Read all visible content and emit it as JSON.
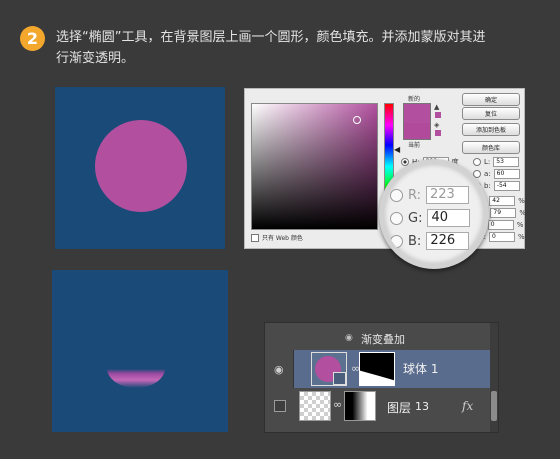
{
  "step": {
    "number": "2",
    "instruction_line1": "选择“椭圆”工具，在背景图层上画一个圆形，颜色填充。并添加蒙版对其进",
    "instruction_line2": "行渐变透明。"
  },
  "colors": {
    "accent": "#f3a72c",
    "canvas_bg": "#1a4a78",
    "fill": "#b2509f",
    "layer_selected": "#5a6c8e"
  },
  "color_picker": {
    "new_label": "新的",
    "current_label": "当前",
    "buttons": [
      "确定",
      "复位",
      "添加到色板",
      "颜色库"
    ],
    "hsb": [
      {
        "label": "H:",
        "value": "298",
        "unit": "度"
      },
      {
        "label": "S:",
        "value": "",
        "unit": "%"
      },
      {
        "label": "B:",
        "value": "",
        "unit": "%"
      }
    ],
    "lab": [
      {
        "label": "L:",
        "value": "53"
      },
      {
        "label": "a:",
        "value": "60"
      },
      {
        "label": "b:",
        "value": "-54"
      }
    ],
    "cmyk": [
      {
        "label": "C:",
        "value": "42",
        "unit": "%"
      },
      {
        "label": "M:",
        "value": "79",
        "unit": "%"
      },
      {
        "label": "Y:",
        "value": "0",
        "unit": "%"
      },
      {
        "label": "K:",
        "value": "0",
        "unit": "%"
      }
    ],
    "web_only_label": "只有 Web 颜色"
  },
  "magnifier": {
    "rows": [
      {
        "label": "R:",
        "value": "223"
      },
      {
        "label": "G:",
        "value": "40"
      },
      {
        "label": "B:",
        "value": "226"
      }
    ]
  },
  "layers_panel": {
    "effect_label": "渐变叠加",
    "layer1_name": "球体 1",
    "layer2_name": "图层",
    "layer2_number": "13",
    "fx_label": "fx"
  },
  "icons": [
    "eye-icon",
    "link-icon",
    "fx-icon",
    "shape-icon"
  ]
}
